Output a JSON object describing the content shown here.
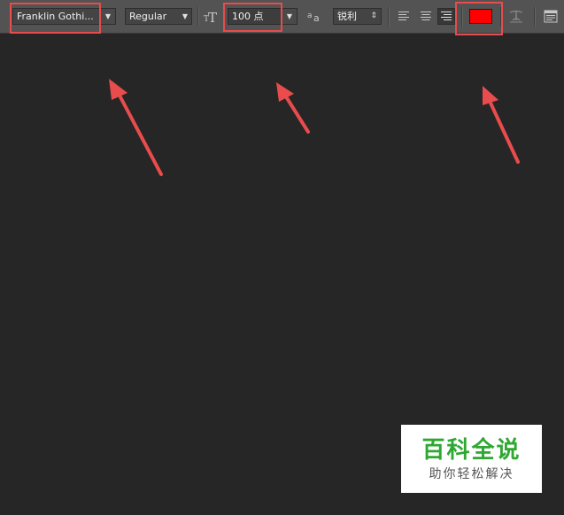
{
  "toolbar": {
    "font_family": {
      "value": "Franklin Gothi..."
    },
    "font_style": {
      "value": "Regular"
    },
    "font_size": {
      "icon": "font-size-icon",
      "value": "100 点"
    },
    "anti_alias": {
      "icon": "anti-alias-icon",
      "value": "锐利"
    },
    "alignment": {
      "options": [
        "align-left",
        "align-center",
        "align-right"
      ],
      "selected": "align-right"
    },
    "text_color": {
      "color": "#ff0000"
    },
    "warp_icon": "warp-text-icon",
    "panel_icon": "character-panel-icon"
  },
  "annotations": {
    "highlight_color": "#e84c4c"
  },
  "watermark": {
    "title": "百科全说",
    "subtitle": "助你轻松解决"
  }
}
